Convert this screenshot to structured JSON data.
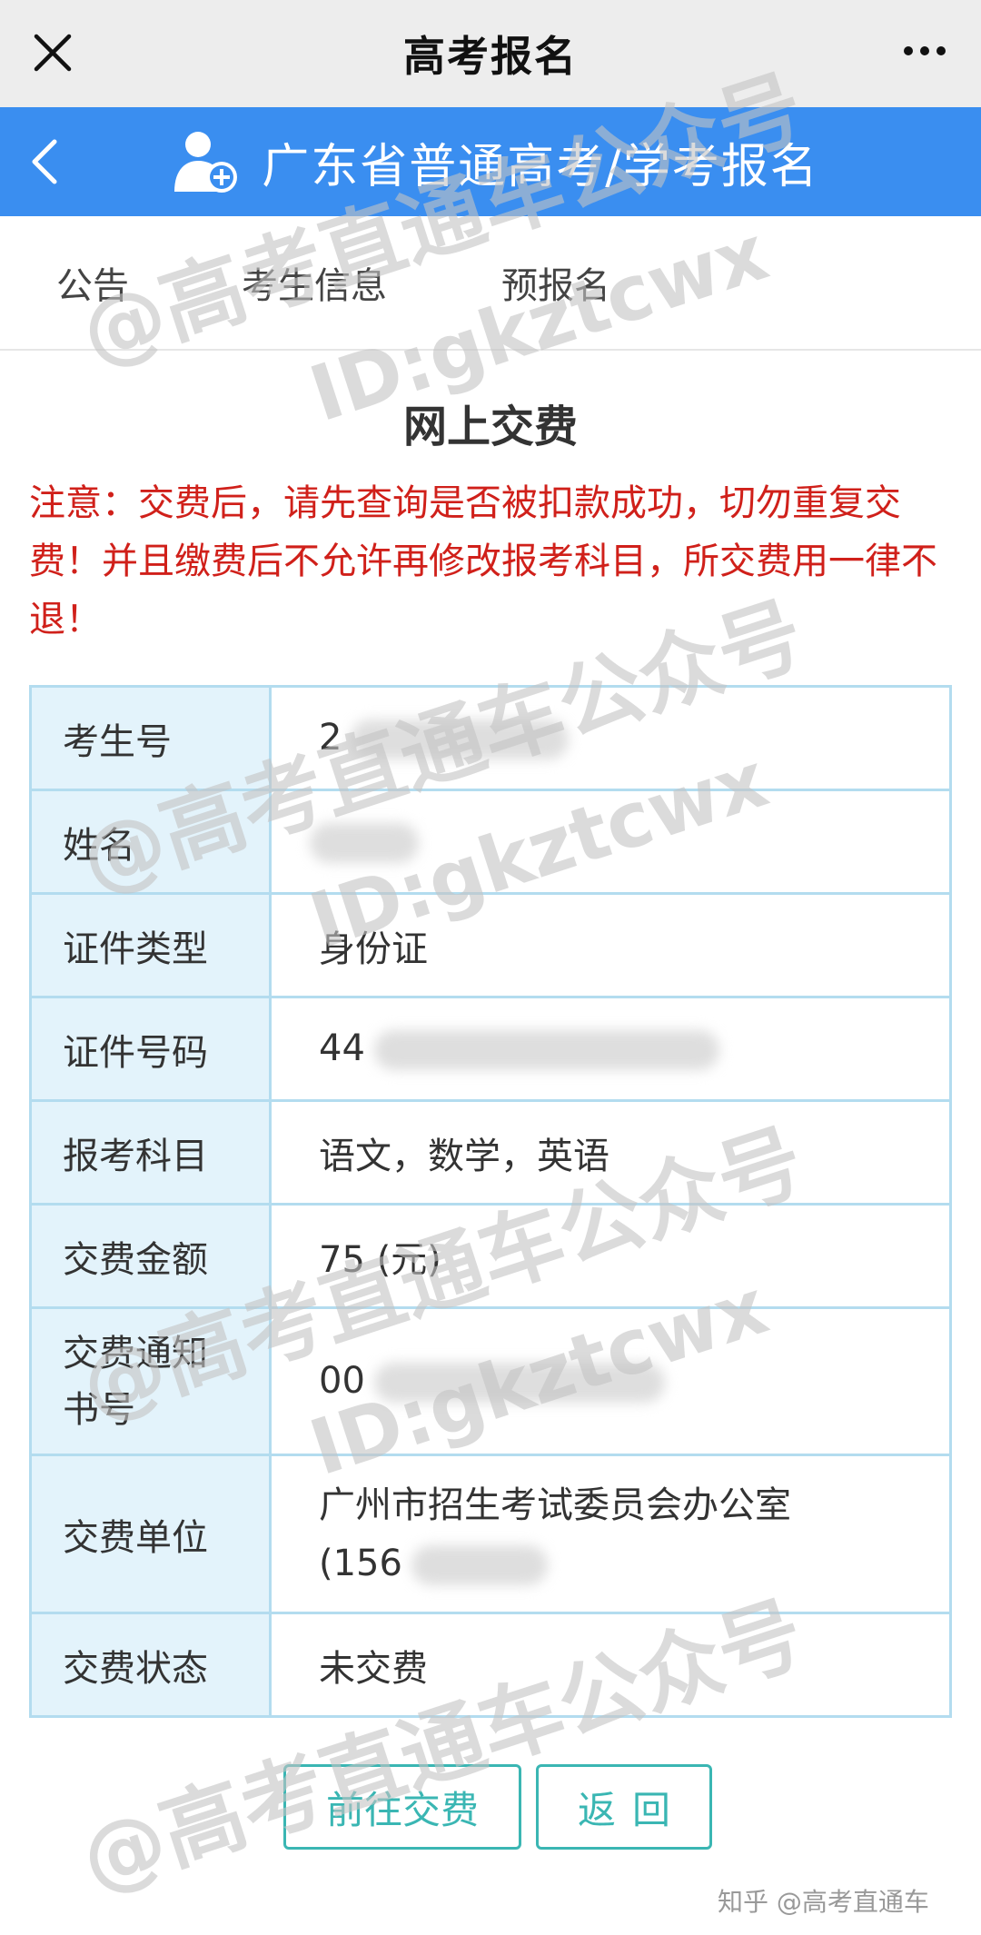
{
  "wechat_bar": {
    "title": "高考报名"
  },
  "header": {
    "title": "广东省普通高考/学考报名"
  },
  "tabs": [
    {
      "label": "公告"
    },
    {
      "label": "考生信息"
    },
    {
      "label": "预报名"
    }
  ],
  "main": {
    "title": "网上交费",
    "notice": "注意：交费后，请先查询是否被扣款成功，切勿重复交费！并且缴费后不允许再修改报考科目，所交费用一律不退！"
  },
  "table": {
    "rows": [
      {
        "label": "考生号",
        "value": "2"
      },
      {
        "label": "姓名",
        "value": ""
      },
      {
        "label": "证件类型",
        "value": "身份证"
      },
      {
        "label": "证件号码",
        "value": "44"
      },
      {
        "label": "报考科目",
        "value": "语文，数学，英语"
      },
      {
        "label": "交费金额",
        "value": "75 (元)"
      },
      {
        "label_line1": "交费通知",
        "label_line2": "书号",
        "value": "00"
      },
      {
        "label": "交费单位",
        "value_line1": "广州市招生考试委员会办公室",
        "value_line2": "(156"
      },
      {
        "label": "交费状态",
        "value": "未交费"
      }
    ]
  },
  "buttons": {
    "pay": "前往交费",
    "back": "返回"
  },
  "footer": {
    "credit": "知乎 @高考直通车"
  },
  "watermark": {
    "line1": "@高考直通车公众号",
    "line2": "ID:gkztcwx"
  },
  "colors": {
    "header_blue": "#3a8ef0",
    "notice_red": "#d0201a",
    "table_border": "#b3dcef",
    "label_bg": "#e3f3fb",
    "button_teal": "#3ab6b3"
  }
}
